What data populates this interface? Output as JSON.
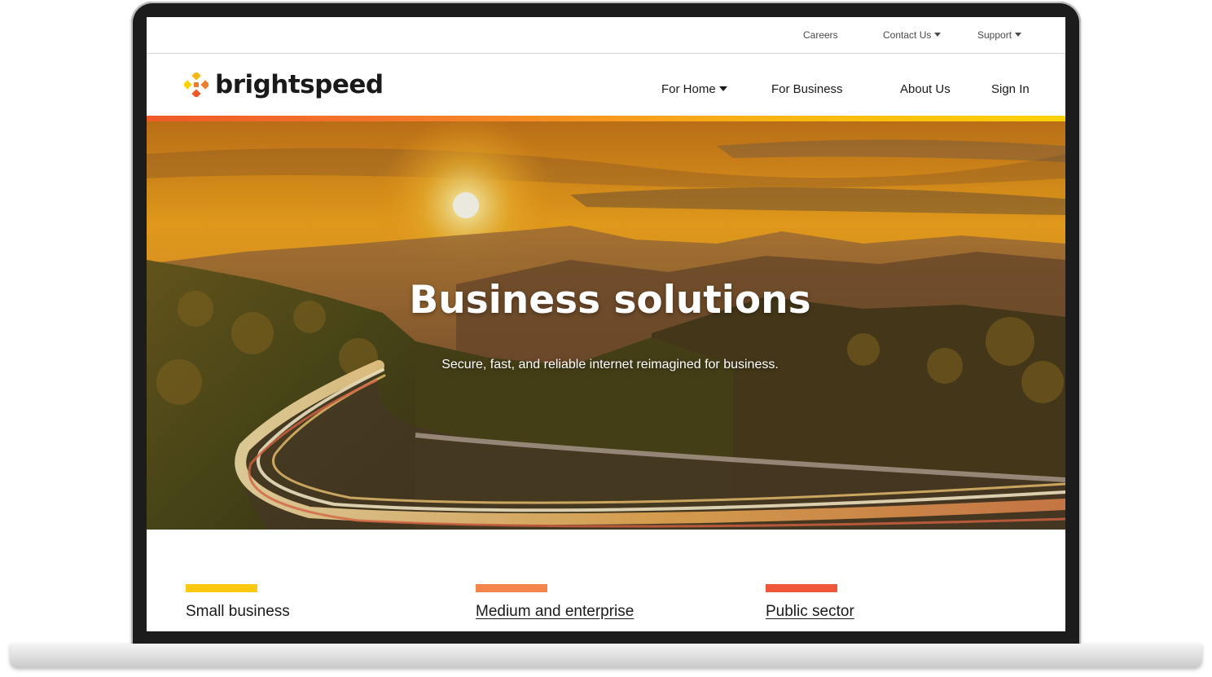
{
  "brand": {
    "name": "brightspeed",
    "logo_colors": [
      "#f8b712",
      "#f47b2a",
      "#f05a28",
      "#fcd107"
    ]
  },
  "utility_nav": {
    "items": [
      {
        "label": "Careers",
        "has_dropdown": false
      },
      {
        "label": "Contact Us",
        "has_dropdown": true
      },
      {
        "label": "Support",
        "has_dropdown": true
      }
    ]
  },
  "main_nav": {
    "items": [
      {
        "label": "For Home",
        "has_dropdown": true
      },
      {
        "label": "For Business",
        "has_dropdown": false
      },
      {
        "label": "About Us",
        "has_dropdown": false
      },
      {
        "label": "Sign In",
        "has_dropdown": false
      }
    ]
  },
  "accent_gradient": [
    "#f05a28",
    "#f47b2a",
    "#f8b712",
    "#fcd107"
  ],
  "hero": {
    "title": "Business solutions",
    "subtitle": "Secure, fast, and reliable internet reimagined for business.",
    "image": "sunset-mountain-highway-light-trails"
  },
  "segments": [
    {
      "label": "Small business",
      "color": "#fcc90f",
      "link": false
    },
    {
      "label": "Medium and enterprise",
      "color": "#f5854a",
      "link": true
    },
    {
      "label": "Public sector",
      "color": "#f0563a",
      "link": true
    }
  ]
}
